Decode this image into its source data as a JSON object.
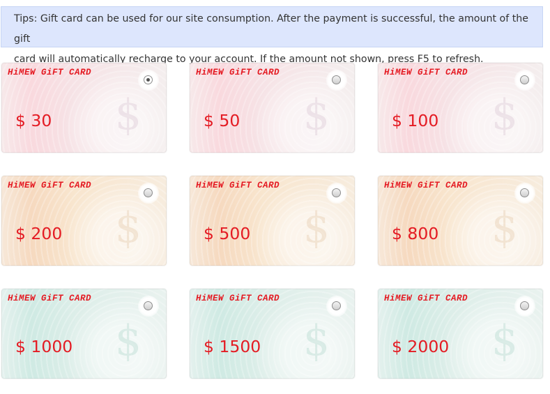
{
  "tips": {
    "line1": "Tips: Gift card can be used for our site consumption. After the payment is successful, the amount of the gift",
    "line2": "card will automatically recharge to your account. If the amount not shown, press F5 to refresh."
  },
  "cards": [
    {
      "brand": "HiMEW GiFT CARD",
      "amount": "$ 30",
      "theme": "pink",
      "selected": true
    },
    {
      "brand": "HiMEW GiFT CARD",
      "amount": "$ 50",
      "theme": "pink",
      "selected": false
    },
    {
      "brand": "HiMEW GiFT CARD",
      "amount": "$ 100",
      "theme": "pink",
      "selected": false
    },
    {
      "brand": "HiMEW GiFT CARD",
      "amount": "$ 200",
      "theme": "orange",
      "selected": false
    },
    {
      "brand": "HiMEW GiFT CARD",
      "amount": "$ 500",
      "theme": "orange",
      "selected": false
    },
    {
      "brand": "HiMEW GiFT CARD",
      "amount": "$ 800",
      "theme": "orange",
      "selected": false
    },
    {
      "brand": "HiMEW GiFT CARD",
      "amount": "$ 1000",
      "theme": "teal",
      "selected": false
    },
    {
      "brand": "HiMEW GiFT CARD",
      "amount": "$ 1500",
      "theme": "teal",
      "selected": false
    },
    {
      "brand": "HiMEW GiFT CARD",
      "amount": "$ 2000",
      "theme": "teal",
      "selected": false
    }
  ],
  "colors": {
    "amount_text": "#e41b23",
    "tips_background": "#dde6fd"
  }
}
